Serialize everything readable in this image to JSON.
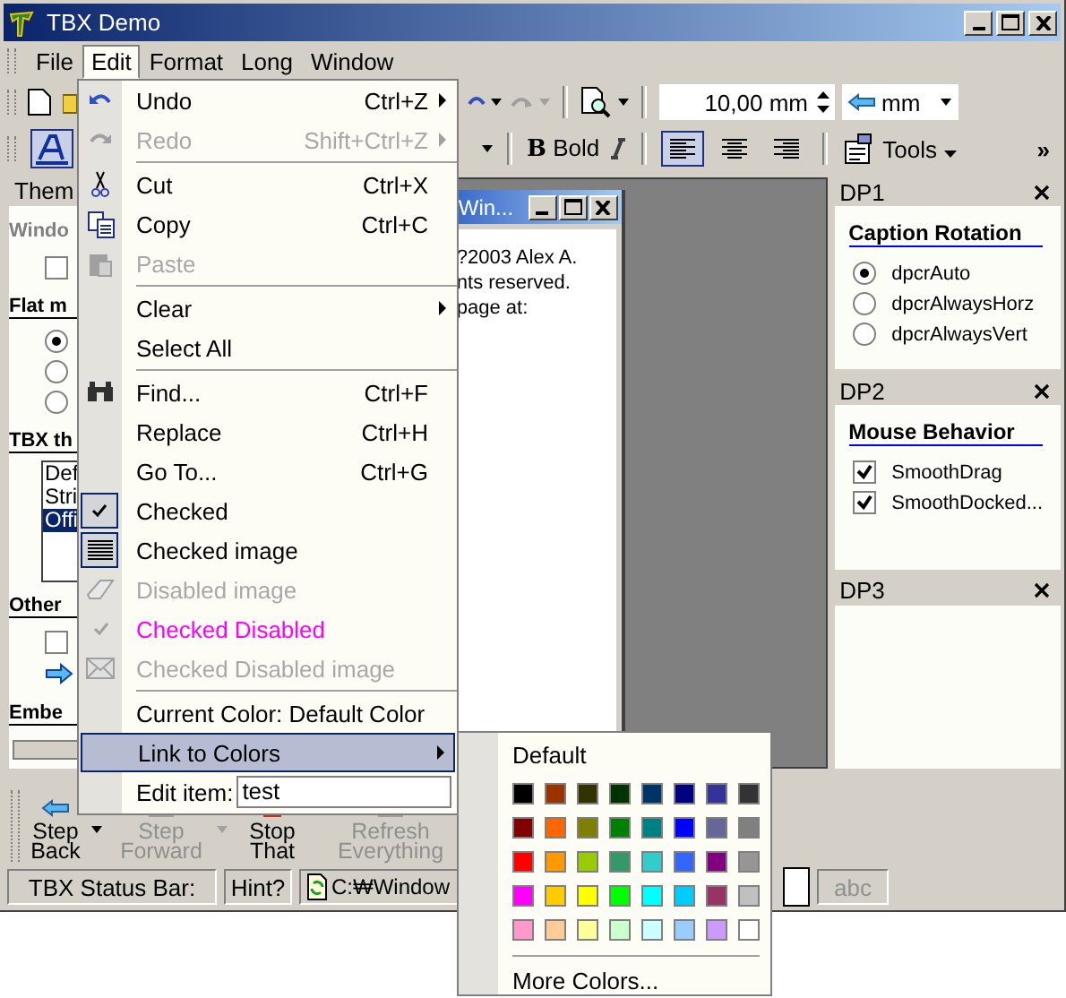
{
  "window": {
    "title": "TBX Demo"
  },
  "menu_bar": [
    {
      "label": "File",
      "selected": false
    },
    {
      "label": "Edit",
      "selected": true
    },
    {
      "label": "Format",
      "selected": false
    },
    {
      "label": "Long",
      "selected": false
    },
    {
      "label": "Window",
      "selected": false
    }
  ],
  "toolbar": {
    "size_value": "10,00 mm",
    "unit": "mm"
  },
  "format_toolbar": {
    "bold_icon": "B",
    "bold_label": "Bold",
    "tools_label": "Tools",
    "chevron": "»",
    "align": [
      {
        "kind": "left",
        "selected": true
      },
      {
        "kind": "center",
        "selected": false
      },
      {
        "kind": "right",
        "selected": false
      }
    ]
  },
  "left_panel": {
    "tab": "Them",
    "items": [
      {
        "kind": "heading",
        "label": "Windo",
        "disabled": true
      },
      {
        "kind": "checkbox",
        "checked": false
      },
      {
        "kind": "heading",
        "label": "Flat m",
        "disabled": false
      },
      {
        "kind": "radio",
        "selected": true
      },
      {
        "kind": "radio",
        "selected": false
      },
      {
        "kind": "radio",
        "selected": false
      },
      {
        "kind": "heading",
        "label": "TBX th",
        "disabled": false
      },
      {
        "kind": "list",
        "entries": [
          {
            "label": "Def",
            "selected": false
          },
          {
            "label": "Stri",
            "selected": false
          },
          {
            "label": "Offi",
            "selected": true
          }
        ]
      },
      {
        "kind": "heading",
        "label": "Other",
        "disabled": false
      },
      {
        "kind": "checkbox",
        "checked": false
      },
      {
        "kind": "arrow"
      },
      {
        "kind": "heading",
        "label": "Embe",
        "disabled": false
      }
    ]
  },
  "child_window": {
    "title": "Win...",
    "lines": [
      "?2003 Alex A.",
      "nts reserved.",
      "page at:"
    ]
  },
  "dock_panels": [
    {
      "title": "DP1",
      "heading": "Caption Rotation",
      "options": [
        {
          "kind": "radio",
          "label": "dpcrAuto",
          "checked": true
        },
        {
          "kind": "radio",
          "label": "dpcrAlwaysHorz",
          "checked": false
        },
        {
          "kind": "radio",
          "label": "dpcrAlwaysVert",
          "checked": false
        }
      ]
    },
    {
      "title": "DP2",
      "heading": "Mouse Behavior",
      "options": [
        {
          "kind": "checkbox",
          "label": "SmoothDrag",
          "checked": true
        },
        {
          "kind": "checkbox",
          "label": "SmoothDocked...",
          "checked": true
        }
      ]
    },
    {
      "title": "DP3"
    }
  ],
  "edit_menu": [
    {
      "kind": "item",
      "label": "Undo",
      "shortcut": "Ctrl+Z",
      "disabled": false,
      "checked": false,
      "submenu": true,
      "selected": false
    },
    {
      "kind": "item",
      "label": "Redo",
      "shortcut": "Shift+Ctrl+Z",
      "disabled": true,
      "submenu": true,
      "selected": false
    },
    {
      "kind": "separator"
    },
    {
      "kind": "item",
      "label": "Cut",
      "shortcut": "Ctrl+X",
      "disabled": false,
      "checked": false,
      "submenu": false,
      "selected": false
    },
    {
      "kind": "item",
      "label": "Copy",
      "shortcut": "Ctrl+C",
      "disabled": false,
      "checked": false,
      "submenu": false,
      "selected": false
    },
    {
      "kind": "item",
      "label": "Paste",
      "disabled": true,
      "submenu": false,
      "selected": false
    },
    {
      "kind": "separator"
    },
    {
      "kind": "item",
      "label": "Clear",
      "disabled": false,
      "checked": false,
      "submenu": true,
      "selected": false
    },
    {
      "kind": "item",
      "label": "Select All",
      "disabled": false,
      "checked": false,
      "submenu": false,
      "selected": false
    },
    {
      "kind": "separator"
    },
    {
      "kind": "item",
      "label": "Find...",
      "shortcut": "Ctrl+F",
      "disabled": false,
      "checked": false,
      "submenu": false,
      "selected": false
    },
    {
      "kind": "item",
      "label": "Replace",
      "shortcut": "Ctrl+H",
      "disabled": false,
      "checked": false,
      "submenu": false,
      "selected": false
    },
    {
      "kind": "item",
      "label": "Go To...",
      "shortcut": "Ctrl+G",
      "disabled": false,
      "checked": false,
      "submenu": false,
      "selected": false
    },
    {
      "kind": "item",
      "label": "Checked",
      "disabled": false,
      "checked": true,
      "submenu": false,
      "selected": false
    },
    {
      "kind": "item",
      "label": "Checked image",
      "disabled": false,
      "checked": true,
      "submenu": false,
      "selected": false
    },
    {
      "kind": "item",
      "label": "Disabled image",
      "disabled": true,
      "submenu": false,
      "selected": false
    },
    {
      "kind": "item",
      "label": "Checked Disabled",
      "disabled": true,
      "submenu": false,
      "selected": false,
      "color": "#ff00ff"
    },
    {
      "kind": "item",
      "label": "Checked Disabled image",
      "disabled": true,
      "submenu": false,
      "selected": false
    },
    {
      "kind": "separator"
    },
    {
      "kind": "item",
      "label": "Current Color: Default Color",
      "disabled": false,
      "checked": false,
      "submenu": false,
      "selected": false
    },
    {
      "kind": "item",
      "label": "Link to Colors",
      "disabled": false,
      "checked": false,
      "submenu": true,
      "selected": true
    },
    {
      "kind": "edit",
      "label": "Edit item:",
      "value": "test"
    }
  ],
  "color_menu": {
    "default_label": "Default",
    "more_label": "More Colors...",
    "colors": [
      {
        "color": "#000000"
      },
      {
        "color": "#993300"
      },
      {
        "color": "#333300"
      },
      {
        "color": "#003300"
      },
      {
        "color": "#003366"
      },
      {
        "color": "#000080"
      },
      {
        "color": "#333399"
      },
      {
        "color": "#333333"
      },
      {
        "color": "#800000"
      },
      {
        "color": "#ff6600"
      },
      {
        "color": "#808000"
      },
      {
        "color": "#008000"
      },
      {
        "color": "#008080"
      },
      {
        "color": "#0000ff"
      },
      {
        "color": "#666699"
      },
      {
        "color": "#808080"
      },
      {
        "color": "#ff0000"
      },
      {
        "color": "#ff9900"
      },
      {
        "color": "#99cc00"
      },
      {
        "color": "#339966"
      },
      {
        "color": "#33cccc"
      },
      {
        "color": "#3366ff"
      },
      {
        "color": "#800080"
      },
      {
        "color": "#969696"
      },
      {
        "color": "#ff00ff"
      },
      {
        "color": "#ffcc00"
      },
      {
        "color": "#ffff00"
      },
      {
        "color": "#00ff00"
      },
      {
        "color": "#00ffff"
      },
      {
        "color": "#00ccff"
      },
      {
        "color": "#993366"
      },
      {
        "color": "#c0c0c0"
      },
      {
        "color": "#ff99cc"
      },
      {
        "color": "#ffcc99"
      },
      {
        "color": "#ffff99"
      },
      {
        "color": "#ccffcc"
      },
      {
        "color": "#ccffff"
      },
      {
        "color": "#99ccff"
      },
      {
        "color": "#cc99ff"
      },
      {
        "color": "#ffffff"
      }
    ]
  },
  "bottom_toolbar": [
    {
      "label": "Step Back",
      "disabled": false,
      "dropdown": true
    },
    {
      "label": "Step Forward",
      "disabled": true,
      "dropdown": true
    },
    {
      "label": "Stop That",
      "disabled": false,
      "dropdown": false
    },
    {
      "label": "Refresh Everything",
      "disabled": true,
      "dropdown": false
    }
  ],
  "status_bar": {
    "caption": "TBX Status Bar:",
    "hint": "Hint?",
    "path": "C:₩Window",
    "trailing": "abc"
  }
}
